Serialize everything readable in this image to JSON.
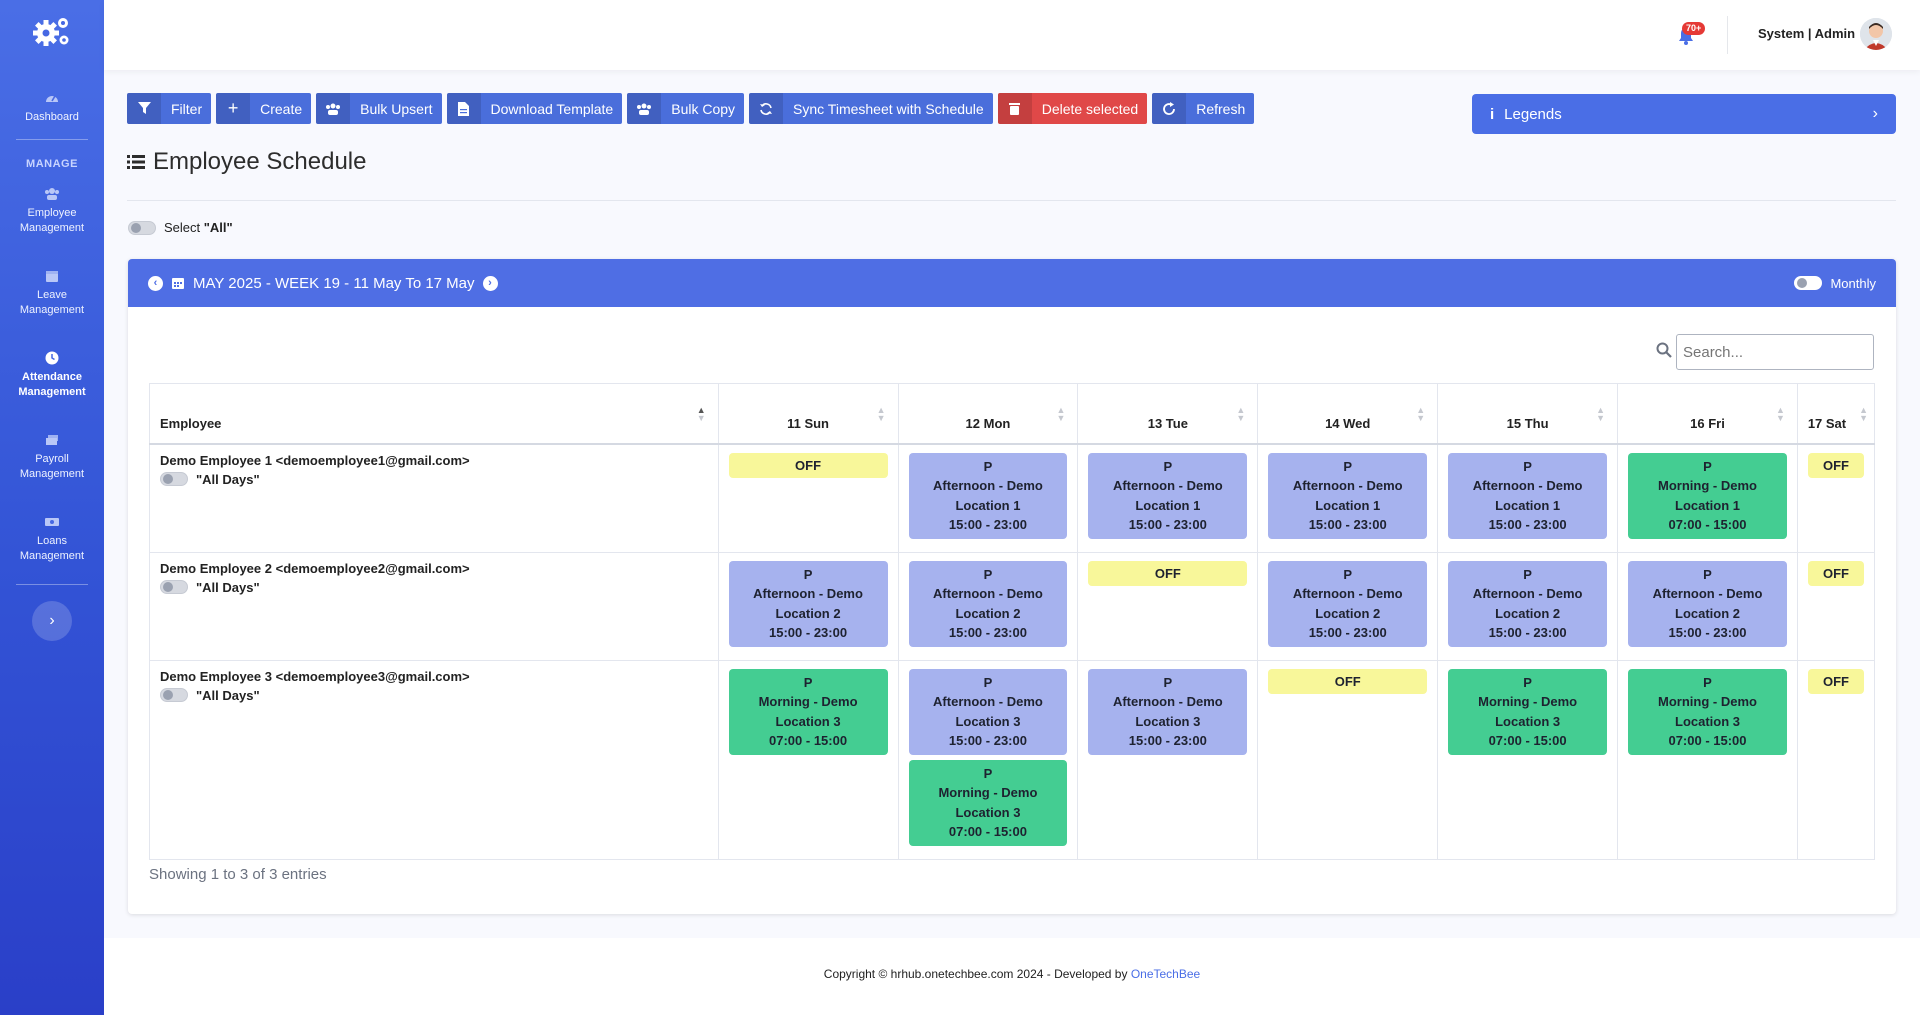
{
  "sidebar": {
    "items": [
      {
        "label": "Dashboard",
        "icon": "dashboard-icon"
      },
      {
        "label": "Employee Management",
        "icon": "users-icon"
      },
      {
        "label": "Leave Management",
        "icon": "calendar-icon"
      },
      {
        "label": "Attendance Management",
        "icon": "clock-icon"
      },
      {
        "label": "Payroll Management",
        "icon": "money-icon"
      },
      {
        "label": "Loans Management",
        "icon": "cash-icon"
      }
    ],
    "section_heading": "MANAGE"
  },
  "header": {
    "notification_badge": "70+",
    "user": "System | Admin"
  },
  "toolbar": {
    "filter": "Filter",
    "create": "Create",
    "bulk_upsert": "Bulk Upsert",
    "download_template": "Download Template",
    "bulk_copy": "Bulk Copy",
    "sync": "Sync Timesheet with Schedule",
    "delete_selected": "Delete selected",
    "refresh": "Refresh"
  },
  "legends": {
    "label": "Legends"
  },
  "page": {
    "title": "Employee Schedule",
    "select_all_prefix": "Select ",
    "select_all_value": "\"All\""
  },
  "schedule": {
    "week_label": "MAY 2025 - WEEK 19 - 11 May To 17 May",
    "monthly_label": "Monthly",
    "search_placeholder": "Search...",
    "columns": [
      "Employee",
      "11 Sun",
      "12 Mon",
      "13 Tue",
      "14 Wed",
      "15 Thu",
      "16 Fri",
      "17 Sat"
    ],
    "all_days_label": "\"All Days\"",
    "rows": [
      {
        "employee": "Demo Employee 1 <demoemployee1@gmail.com>",
        "days": [
          [
            {
              "type": "off",
              "text": "OFF"
            }
          ],
          [
            {
              "type": "aft",
              "code": "P",
              "name": "Afternoon - Demo Location 1",
              "time": "15:00 - 23:00"
            }
          ],
          [
            {
              "type": "aft",
              "code": "P",
              "name": "Afternoon - Demo Location 1",
              "time": "15:00 - 23:00"
            }
          ],
          [
            {
              "type": "aft",
              "code": "P",
              "name": "Afternoon - Demo Location 1",
              "time": "15:00 - 23:00"
            }
          ],
          [
            {
              "type": "aft",
              "code": "P",
              "name": "Afternoon - Demo Location 1",
              "time": "15:00 - 23:00"
            }
          ],
          [
            {
              "type": "mor",
              "code": "P",
              "name": "Morning - Demo Location 1",
              "time": "07:00 - 15:00"
            }
          ],
          [
            {
              "type": "off",
              "text": "OFF"
            }
          ]
        ]
      },
      {
        "employee": "Demo Employee 2 <demoemployee2@gmail.com>",
        "days": [
          [
            {
              "type": "aft",
              "code": "P",
              "name": "Afternoon - Demo Location 2",
              "time": "15:00 - 23:00"
            }
          ],
          [
            {
              "type": "aft",
              "code": "P",
              "name": "Afternoon - Demo Location 2",
              "time": "15:00 - 23:00"
            }
          ],
          [
            {
              "type": "off",
              "text": "OFF"
            }
          ],
          [
            {
              "type": "aft",
              "code": "P",
              "name": "Afternoon - Demo Location 2",
              "time": "15:00 - 23:00"
            }
          ],
          [
            {
              "type": "aft",
              "code": "P",
              "name": "Afternoon - Demo Location 2",
              "time": "15:00 - 23:00"
            }
          ],
          [
            {
              "type": "aft",
              "code": "P",
              "name": "Afternoon - Demo Location 2",
              "time": "15:00 - 23:00"
            }
          ],
          [
            {
              "type": "off",
              "text": "OFF"
            }
          ]
        ]
      },
      {
        "employee": "Demo Employee 3 <demoemployee3@gmail.com>",
        "days": [
          [
            {
              "type": "mor",
              "code": "P",
              "name": "Morning - Demo Location 3",
              "time": "07:00 - 15:00"
            }
          ],
          [
            {
              "type": "aft",
              "code": "P",
              "name": "Afternoon - Demo Location 3",
              "time": "15:00 - 23:00"
            },
            {
              "type": "mor",
              "code": "P",
              "name": "Morning - Demo Location 3",
              "time": "07:00 - 15:00"
            }
          ],
          [
            {
              "type": "aft",
              "code": "P",
              "name": "Afternoon - Demo Location 3",
              "time": "15:00 - 23:00"
            }
          ],
          [
            {
              "type": "off",
              "text": "OFF"
            }
          ],
          [
            {
              "type": "mor",
              "code": "P",
              "name": "Morning - Demo Location 3",
              "time": "07:00 - 15:00"
            }
          ],
          [
            {
              "type": "mor",
              "code": "P",
              "name": "Morning - Demo Location 3",
              "time": "07:00 - 15:00"
            }
          ],
          [
            {
              "type": "off",
              "text": "OFF"
            }
          ]
        ]
      }
    ],
    "entries_text": "Showing 1 to 3 of 3 entries"
  },
  "footer": {
    "text": "Copyright © hrhub.onetechbee.com 2024 - Developed by ",
    "developer": "OneTechBee"
  },
  "colors": {
    "primary": "#4f6ee4",
    "danger": "#e04848",
    "afternoon_shift": "#a6b2ee",
    "morning_shift": "#44cd92",
    "off_shift": "#f8f79a"
  }
}
